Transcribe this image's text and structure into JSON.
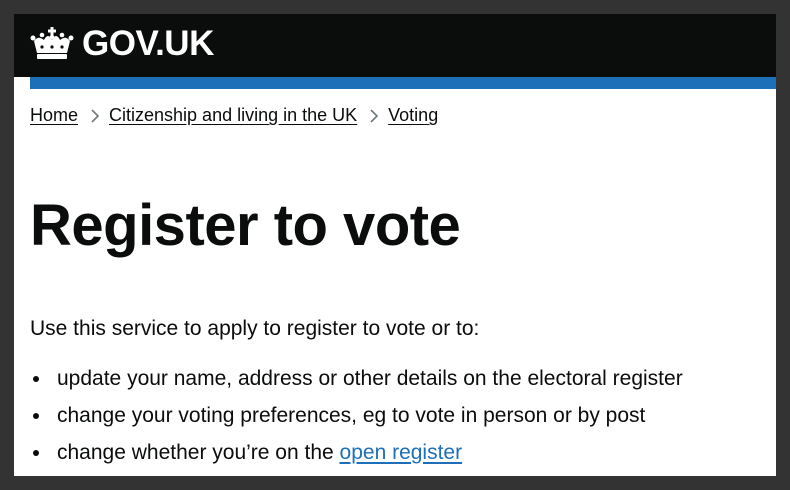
{
  "header": {
    "logo_text": "GOV.UK",
    "logo_icon": "crown-icon",
    "background": "#0b0c0c",
    "accent_bar": "#1d70b8"
  },
  "breadcrumbs": [
    {
      "label": "Home"
    },
    {
      "label": "Citizenship and living in the UK"
    },
    {
      "label": "Voting"
    }
  ],
  "main": {
    "title": "Register to vote",
    "intro": "Use this service to apply to register to vote or to:",
    "list": [
      {
        "text": "update your name, address or other details on the electoral register"
      },
      {
        "text": "change your voting preferences, eg to vote in person or by post"
      },
      {
        "text": "change whether you’re on the ",
        "link": "open register"
      }
    ],
    "link_color": "#1d70b8"
  }
}
